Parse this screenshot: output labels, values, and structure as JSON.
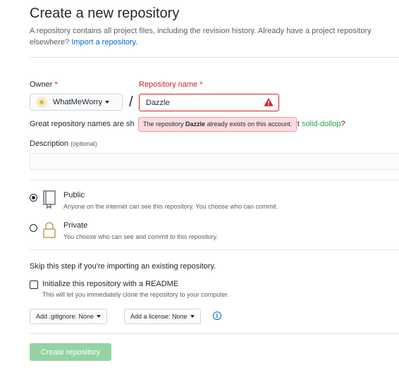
{
  "header": {
    "title": "Create a new repository",
    "intro": "A repository contains all project files, including the revision history. Already have a project repository elsewhere?",
    "import_link": "Import a repository."
  },
  "owner": {
    "label": "Owner",
    "required_mark": "*",
    "value": "WhatMeWorry"
  },
  "slash": "/",
  "repo_name": {
    "label": "Repository name",
    "required_mark": "*",
    "value": "Dazzle",
    "error_tooltip_prefix": "The repository ",
    "error_tooltip_name": "Dazzle",
    "error_tooltip_suffix": " already exists on this account."
  },
  "help": {
    "text_start": "Great repository names are sh",
    "text_end": "ut ",
    "suggestion": "solid-dollop",
    "question_mark": "?"
  },
  "description": {
    "label": "Description",
    "optional": "(optional)",
    "value": ""
  },
  "visibility": {
    "public": {
      "title": "Public",
      "desc": "Anyone on the internet can see this repository. You choose who can commit.",
      "selected": true
    },
    "private": {
      "title": "Private",
      "desc": "You choose who can see and commit to this repository.",
      "selected": false
    }
  },
  "init": {
    "skip_text": "Skip this step if you're importing an existing repository.",
    "readme_label": "Initialize this repository with a README",
    "readme_desc": "This will let you immediately clone the repository to your computer.",
    "checked": false
  },
  "gitignore_button": "Add .gitignore: None",
  "license_button": "Add a license: None",
  "info_icon_glyph": "i",
  "create_button": "Create repository",
  "colors": {
    "error": "#cb2431",
    "link": "#0366d6",
    "success": "#28a745",
    "create_disabled": "#94d3a2"
  }
}
